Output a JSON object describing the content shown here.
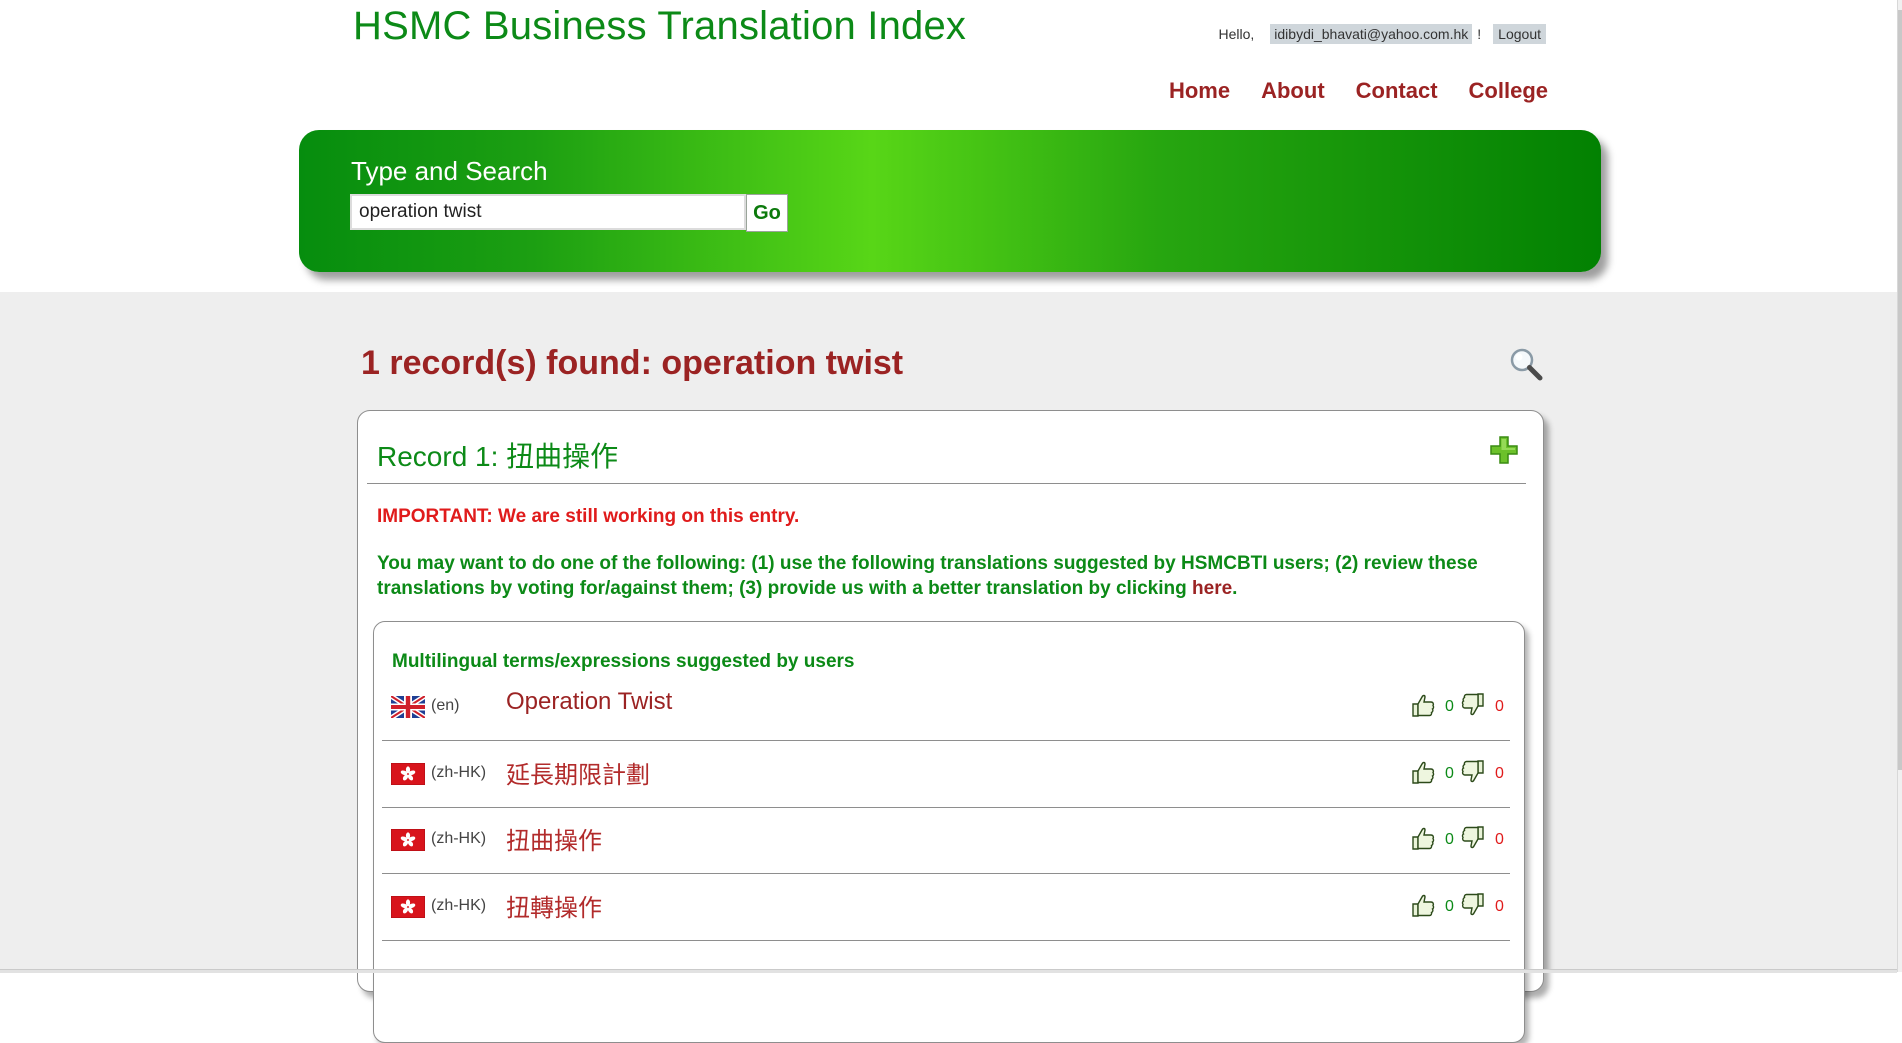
{
  "header": {
    "site_title": "HSMC Business Translation Index",
    "hello_label": "Hello,",
    "user_email": "idibydi_bhavati@yahoo.com.hk",
    "exclamation": "!",
    "logout_label": "Logout"
  },
  "nav": {
    "items": [
      {
        "label": "Home"
      },
      {
        "label": "About"
      },
      {
        "label": "Contact"
      },
      {
        "label": "College"
      }
    ]
  },
  "search": {
    "label": "Type and Search",
    "value": "operation twist",
    "go_label": "Go"
  },
  "results": {
    "heading": "1 record(s) found: operation twist"
  },
  "record": {
    "title": "Record 1: 扭曲操作",
    "important": "IMPORTANT: We are still working on this entry.",
    "notice_prefix": "You may want to do one of the following: (1) use the following translations suggested by HSMCBTI users; (2) review these translations by voting for/against them; (3) provide us with a better translation by clicking ",
    "here_link": "here",
    "notice_suffix": "."
  },
  "terms": {
    "heading": "Multilingual terms/expressions suggested by users",
    "items": [
      {
        "lang": "(en)",
        "term": "Operation Twist",
        "up": "0",
        "down": "0",
        "flag": "uk-flag-icon"
      },
      {
        "lang": "(zh-HK)",
        "term": "延長期限計劃",
        "up": "0",
        "down": "0",
        "flag": "hk-flag-icon"
      },
      {
        "lang": "(zh-HK)",
        "term": "扭曲操作",
        "up": "0",
        "down": "0",
        "flag": "hk-flag-icon"
      },
      {
        "lang": "(zh-HK)",
        "term": "扭轉操作",
        "up": "0",
        "down": "0",
        "flag": "hk-flag-icon"
      }
    ]
  },
  "colors": {
    "brand_green": "#0c8a17",
    "heading_red": "#9b2323",
    "alert_red": "#e01b1b",
    "panel_gradient_light": "#58d617",
    "panel_gradient_dark": "#028102"
  },
  "icons": {
    "search": "magnifier-icon",
    "add": "plus-icon",
    "vote_up": "thumb-up-icon",
    "vote_down": "thumb-down-icon"
  }
}
